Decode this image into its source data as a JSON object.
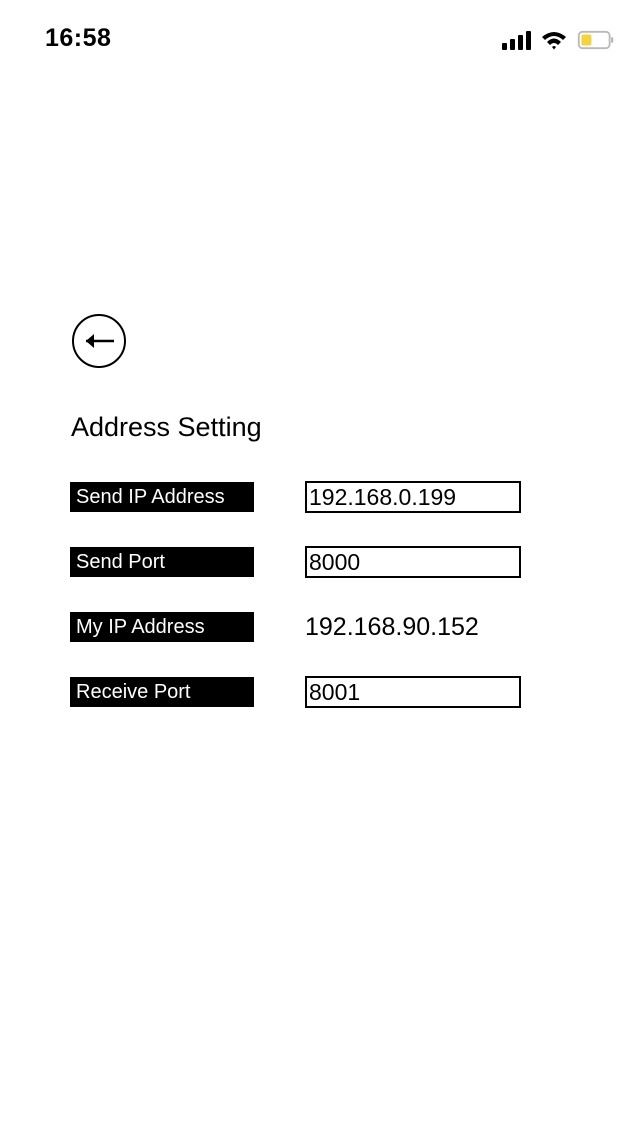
{
  "status_bar": {
    "time": "16:58",
    "icons": [
      "signal-icon",
      "wifi-icon",
      "battery-icon"
    ],
    "battery_color": "#f5d33b"
  },
  "header": {
    "back_icon": "arrow-left-icon",
    "title": "Address Setting"
  },
  "settings": {
    "send_ip": {
      "label": "Send IP Address",
      "value": "192.168.0.199"
    },
    "send_port": {
      "label": "Send Port",
      "value": "8000"
    },
    "my_ip": {
      "label": "My IP Address",
      "value": "192.168.90.152"
    },
    "receive_port": {
      "label": "Receive Port",
      "value": "8001"
    }
  }
}
